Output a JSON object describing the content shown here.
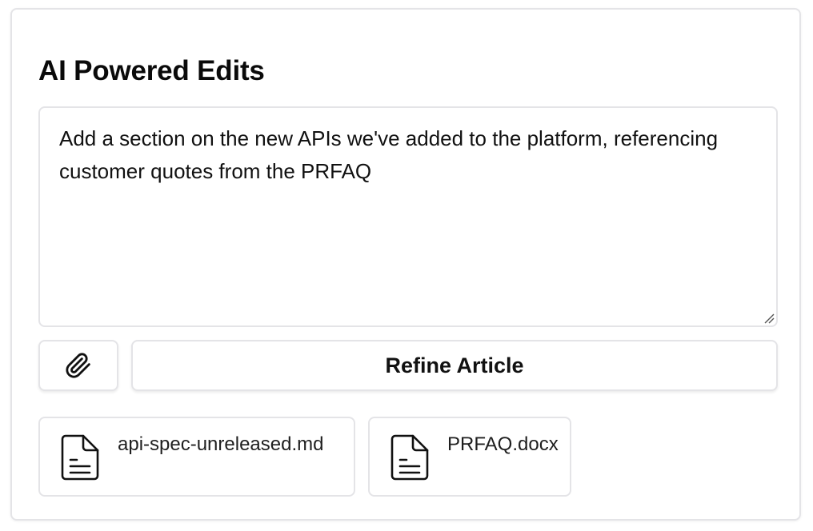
{
  "panel": {
    "title": "AI Powered Edits"
  },
  "prompt": {
    "value": "Add a section on the new APIs we've added to the platform, referencing customer quotes from the PRFAQ"
  },
  "actions": {
    "attach_icon": "paperclip-icon",
    "refine_label": "Refine Article"
  },
  "attachments": [
    {
      "name": "api-spec-unreleased.md",
      "icon": "file-text-icon"
    },
    {
      "name": "PRFAQ.docx",
      "icon": "file-text-icon"
    }
  ],
  "colors": {
    "border": "#e4e4e7",
    "text": "#111111",
    "background": "#ffffff"
  }
}
